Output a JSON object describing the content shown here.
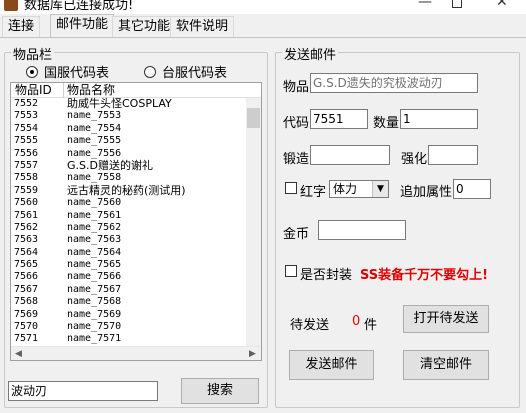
{
  "window": {
    "title": "数据库已连接成功!",
    "minimize_glyph": "—",
    "close_glyph": "✕"
  },
  "tabs": [
    {
      "label": "连接"
    },
    {
      "label": "邮件功能"
    },
    {
      "label": "其它功能"
    },
    {
      "label": "软件说明"
    }
  ],
  "item_panel": {
    "group_title": "物品栏",
    "radio_domestic": "国服代码表",
    "radio_taiwan": "台服代码表",
    "selected": "国服代码表",
    "columns": [
      "物品ID",
      "物品名称"
    ],
    "rows": [
      {
        "id": "7552",
        "name": "助威牛头怪COSPLAY"
      },
      {
        "id": "7553",
        "name": "name_7553"
      },
      {
        "id": "7554",
        "name": "name_7554"
      },
      {
        "id": "7555",
        "name": "name_7555"
      },
      {
        "id": "7556",
        "name": "name_7556"
      },
      {
        "id": "7557",
        "name": "G.S.D赠送的谢礼"
      },
      {
        "id": "7558",
        "name": "name_7558"
      },
      {
        "id": "7559",
        "name": "远古精灵的秘药(测试用)"
      },
      {
        "id": "7560",
        "name": "name_7560"
      },
      {
        "id": "7561",
        "name": "name_7561"
      },
      {
        "id": "7562",
        "name": "name_7562"
      },
      {
        "id": "7563",
        "name": "name_7563"
      },
      {
        "id": "7564",
        "name": "name_7564"
      },
      {
        "id": "7565",
        "name": "name_7565"
      },
      {
        "id": "7566",
        "name": "name_7566"
      },
      {
        "id": "7567",
        "name": "name_7567"
      },
      {
        "id": "7568",
        "name": "name_7568"
      },
      {
        "id": "7569",
        "name": "name_7569"
      },
      {
        "id": "7570",
        "name": "name_7570"
      },
      {
        "id": "7571",
        "name": "name_7571"
      }
    ],
    "search_value": "波动刃",
    "search_button": "搜索"
  },
  "mail_panel": {
    "group_title": "发送邮件",
    "item_label": "物品",
    "item_value": "G.S.D遗失的究极波动刃",
    "code_label": "代码",
    "code_value": "7551",
    "quantity_label": "数量",
    "quantity_value": "1",
    "forge_label": "锻造",
    "forge_value": "",
    "enhance_label": "强化",
    "enhance_value": "",
    "red_label": "红字",
    "red_select": "体力",
    "extra_attr_label": "追加属性",
    "extra_attr_value": "0",
    "gold_label": "金币",
    "gold_value": "",
    "seal_label": "是否封装",
    "warning": "SS装备千万不要勾上!",
    "warning_color": "#e00000",
    "pending_label": "待发送",
    "pending_count": "0",
    "pending_unit": "件",
    "pending_count_color": "#e00000",
    "open_pending_button": "打开待发送",
    "send_button": "发送邮件",
    "clear_button": "清空邮件"
  }
}
